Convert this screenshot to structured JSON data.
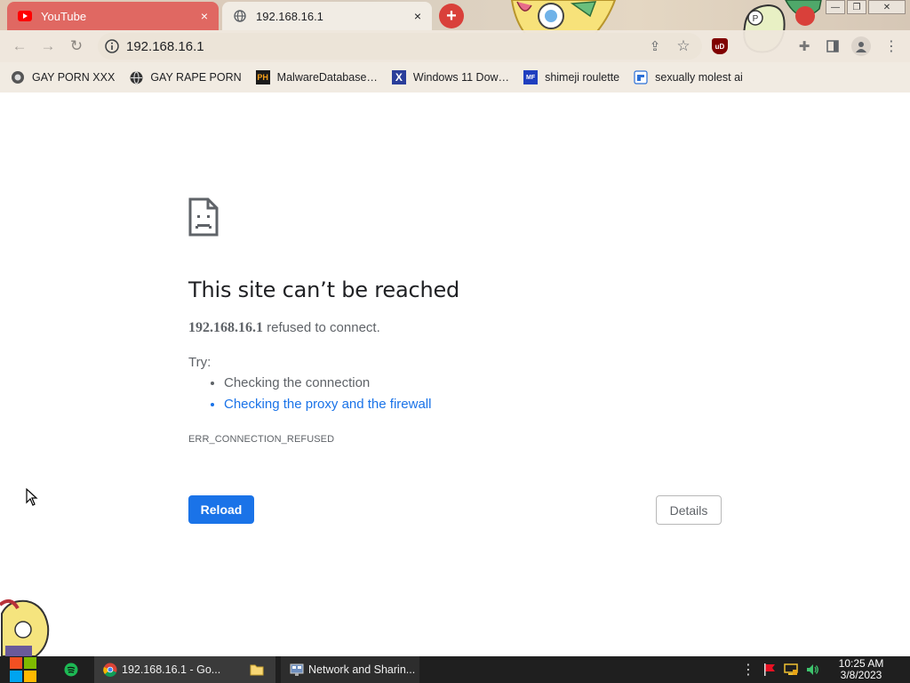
{
  "browser": {
    "tabs": [
      {
        "title": "YouTube",
        "active": false,
        "icon": "youtube-icon"
      },
      {
        "title": "192.168.16.1",
        "active": true,
        "icon": "globe-icon"
      }
    ],
    "new_tab_symbol": "+",
    "close_symbol": "×",
    "window_buttons": {
      "minimize": "—",
      "restore": "❐",
      "close": "✕"
    }
  },
  "toolbar": {
    "back_symbol": "←",
    "forward_symbol": "→",
    "reload_symbol": "↻",
    "url": "192.168.16.1",
    "share_symbol": "⇪",
    "star_symbol": "☆",
    "ublock_label": "uD",
    "extensions_symbol": "✚",
    "menu_symbol": "⋮"
  },
  "bookmarks": [
    {
      "label": "GAY PORN XXX",
      "icon": "bookmark-icon-1"
    },
    {
      "label": "GAY RAPE PORN",
      "icon": "globe-icon"
    },
    {
      "label": "MalwareDatabase…",
      "icon": "ph-icon",
      "icon_text": "PH"
    },
    {
      "label": "Windows 11 Dow…",
      "icon": "x-icon",
      "icon_text": "X"
    },
    {
      "label": "shimeji roulette",
      "icon": "mf-icon",
      "icon_text": "MF"
    },
    {
      "label": "sexually molest ai",
      "icon": "puzzle-icon"
    }
  ],
  "error_page": {
    "title": "This site can’t be reached",
    "host": "192.168.16.1",
    "description_suffix": " refused to connect.",
    "try_label": "Try:",
    "suggestions": [
      {
        "text": "Checking the connection",
        "link": false
      },
      {
        "text": "Checking the proxy and the firewall",
        "link": true
      }
    ],
    "error_code": "ERR_CONNECTION_REFUSED",
    "reload_label": "Reload",
    "details_label": "Details"
  },
  "taskbar": {
    "items": [
      {
        "label": "192.168.16.1 - Go...",
        "icon": "chrome-icon"
      },
      {
        "label": "Network and Sharin...",
        "icon": "network-icon"
      }
    ],
    "clock_time": "10:25 AM",
    "clock_date": "3/8/2023",
    "overflow_symbol": "⋮"
  },
  "colors": {
    "accent_blue": "#1a73e8",
    "youtube_tab": "#e06862",
    "new_tab_red": "#d9403a",
    "taskbar": "#1f1f1f"
  }
}
